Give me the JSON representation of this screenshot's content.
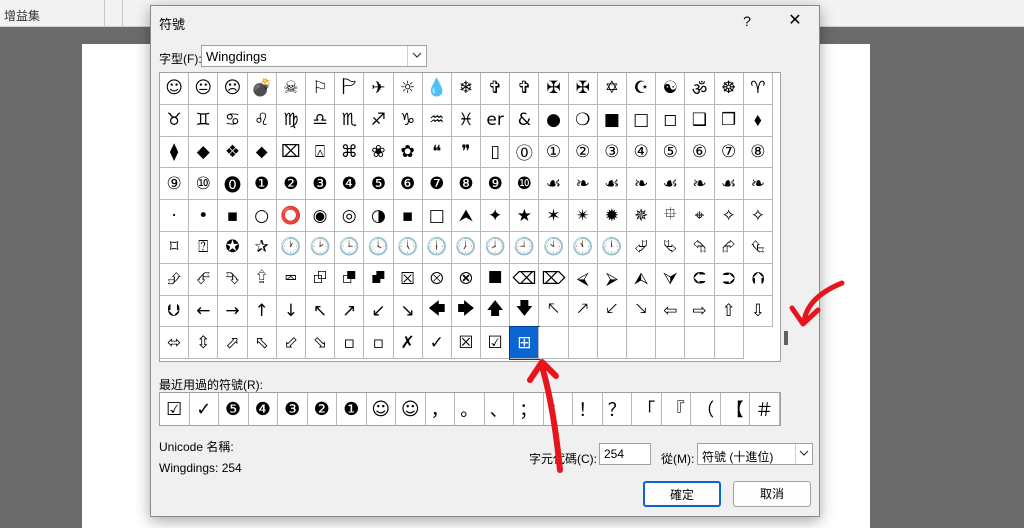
{
  "app": {
    "ribbon_group_label": "增益集"
  },
  "dialog": {
    "title": "符號",
    "help_label": "?",
    "close_label": "✕",
    "font_label": "字型(F):",
    "font_value": "Wingdings",
    "recent_label": "最近用過的符號(R):",
    "unicode_name_label": "Unicode 名稱:",
    "unicode_name_value": "Wingdings: 254",
    "char_code_label": "字元代碼(C):",
    "char_code_value": "254",
    "from_label": "從(M):",
    "from_value": "符號 (十進位)",
    "ok_label": "確定",
    "cancel_label": "取消"
  },
  "symbols": [
    "☺",
    "😐",
    "☹",
    "💣",
    "☠",
    "⚐",
    "🏱",
    "✈",
    "☼",
    "💧",
    "❄",
    "✞",
    "✞",
    "✠",
    "✠",
    "✡",
    "☪",
    "☯",
    "ॐ",
    "☸",
    "♈",
    "♉",
    "♊",
    "♋",
    "♌",
    "♍",
    "♎",
    "♏",
    "♐",
    "♑",
    "♒",
    "♓",
    "er",
    "&",
    "●",
    "❍",
    "■",
    "□",
    "◻",
    "❑",
    "❒",
    "⬧",
    "⧫",
    "◆",
    "❖",
    "⬥",
    "⌧",
    "⍓",
    "⌘",
    "❀",
    "✿",
    "❝",
    "❞",
    "▯",
    "⓪",
    "①",
    "②",
    "③",
    "④",
    "⑤",
    "⑥",
    "⑦",
    "⑧",
    "⑨",
    "⑩",
    "⓿",
    "❶",
    "❷",
    "❸",
    "❹",
    "❺",
    "❻",
    "❼",
    "❽",
    "❾",
    "❿",
    "☙",
    "❧",
    "☙",
    "❧",
    "☙",
    "❧",
    "☙",
    "❧",
    "·",
    "•",
    "▪",
    "○",
    "⭕",
    "◉",
    "◎",
    "◑",
    "▪",
    "□",
    "⮝",
    "✦",
    "★",
    "✶",
    "✴",
    "✹",
    "✵",
    "⯐",
    "⌖",
    "✧",
    "✧",
    "⌑",
    "⍰",
    "✪",
    "✰",
    "🕐",
    "🕑",
    "🕒",
    "🕓",
    "🕔",
    "🕕",
    "🕖",
    "🕗",
    "🕘",
    "🕙",
    "🕚",
    "🕛",
    "⮰",
    "⮱",
    "⮲",
    "⮳",
    "⮴",
    "⮵",
    "⮶",
    "⮷",
    "⮸",
    "⮹",
    "⮺",
    "⮻",
    "⮼",
    "⮽",
    "⮾",
    "⮿",
    "⯀",
    "⌫",
    "⌦",
    "⮘",
    "⮚",
    "⮙",
    "⮛",
    "⮈",
    "⮊",
    "⮉",
    "⮋",
    "←",
    "→",
    "↑",
    "↓",
    "↖",
    "↗",
    "↙",
    "↘",
    "🡄",
    "🡆",
    "🡅",
    "🡇",
    "🡔",
    "🡕",
    "🡗",
    "🡖",
    "⇦",
    "⇨",
    "⇧",
    "⇩",
    "⬄",
    "⇳",
    "⬀",
    "⬁",
    "⬃",
    "⬂",
    "▫",
    "▫",
    "✗",
    "✓",
    "☒",
    "☑",
    "⊞",
    "",
    "",
    "",
    "",
    "",
    "",
    ""
  ],
  "recent_symbols": [
    "☑",
    "✓",
    "❺",
    "❹",
    "❸",
    "❷",
    "❶",
    "☺",
    "☺",
    "，",
    "。",
    "、",
    "；",
    "：",
    "！",
    "？",
    "「",
    "『",
    "（",
    "【",
    "＃"
  ],
  "selected_index": 180
}
